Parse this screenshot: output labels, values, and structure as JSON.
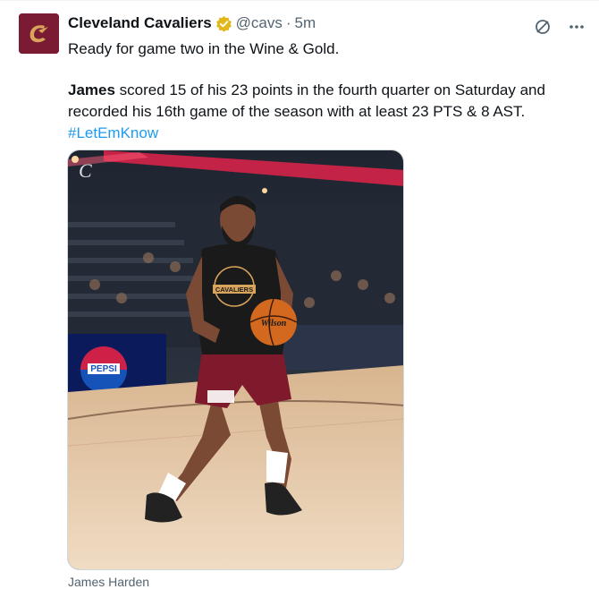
{
  "tweet": {
    "author_name": "Cleveland Cavaliers",
    "handle": "@cavs",
    "separator": "·",
    "time": "5m",
    "line1": "Ready for game two in the Wine & Gold.",
    "line2_bold": "James",
    "line2_rest": " scored 15 of his 23 points in the fourth quarter on Saturday and recorded his 16th game of the season with at least 23 PTS & 8 AST.",
    "hashtag": "#LetEmKnow",
    "media_caption": "James Harden",
    "image_text": {
      "jersey": "CAVALIERS",
      "ball": "Wilson",
      "sign": "PEPSI"
    }
  },
  "icons": {
    "avatar": "cavaliers-logo",
    "verified": "verified-gold-badge",
    "grok": "grok-icon",
    "more": "more-icon"
  },
  "colors": {
    "brand_wine": "#7a1a33",
    "verified_gold": "#e2b719",
    "link": "#1d9bf0",
    "muted": "#536471"
  }
}
